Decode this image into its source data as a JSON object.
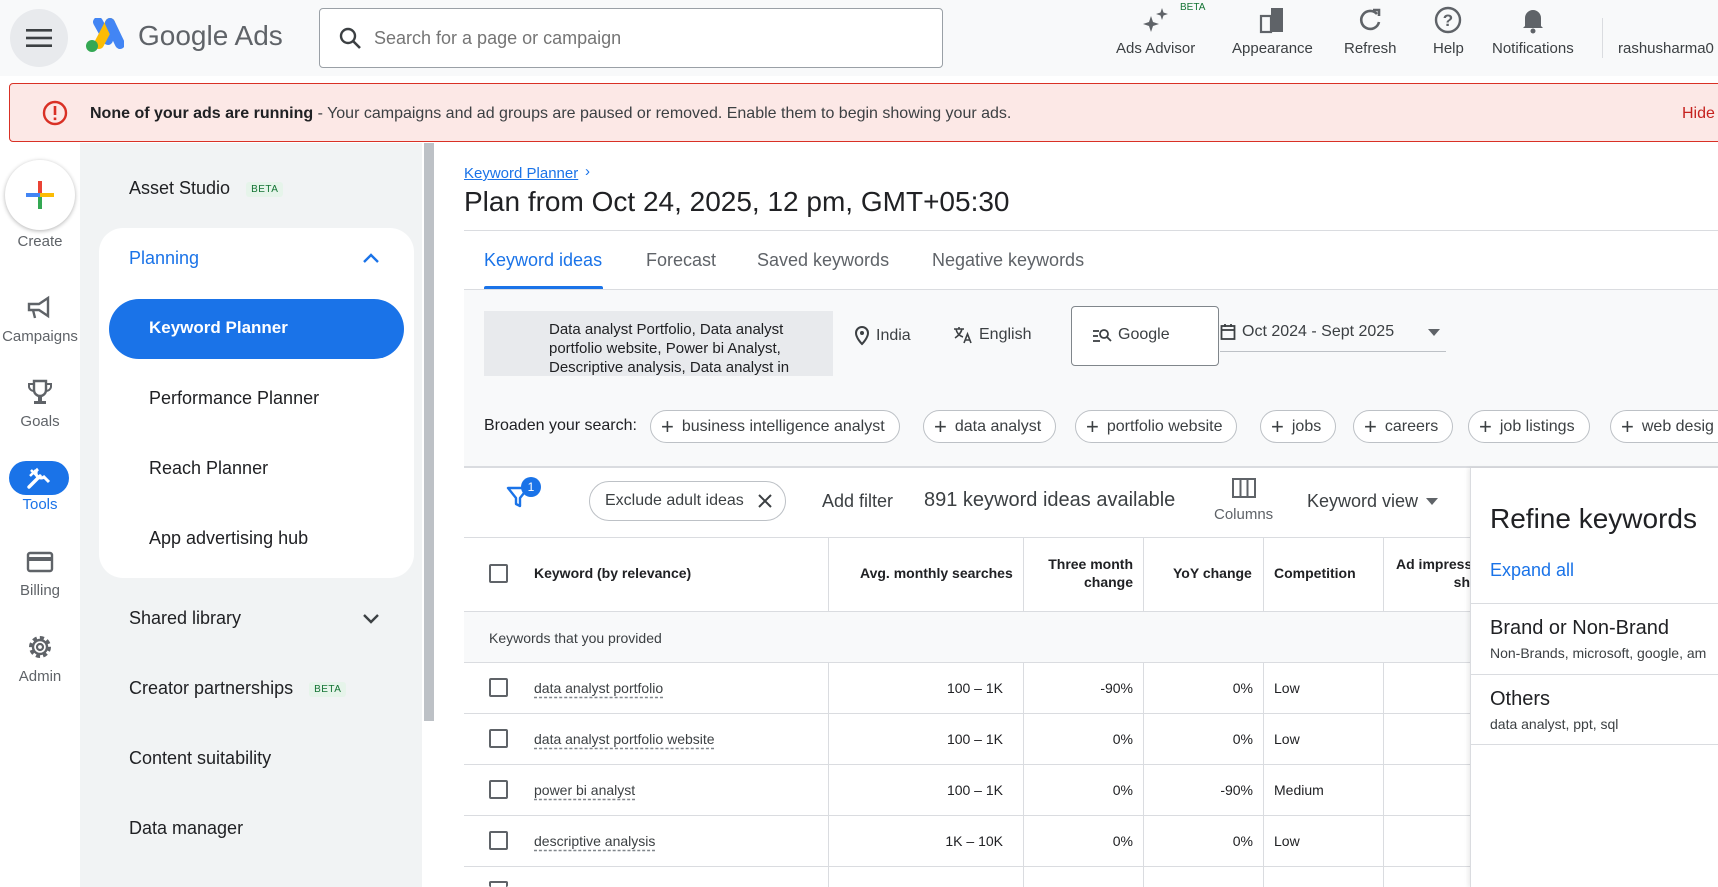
{
  "header": {
    "brand_google": "Google",
    "brand_ads": "Ads",
    "search_placeholder": "Search for a page or campaign",
    "tools": [
      "Ads Advisor",
      "Appearance",
      "Refresh",
      "Help",
      "Notifications"
    ],
    "beta": "BETA",
    "account": "rashusharma0"
  },
  "banner": {
    "bold": "None of your ads are running",
    "text": " - Your campaigns and ad groups are paused or removed. Enable them to begin showing your ads.",
    "hide": "Hide"
  },
  "rail": {
    "create": "Create",
    "items": [
      "Campaigns",
      "Goals",
      "Tools",
      "Billing",
      "Admin"
    ]
  },
  "sidebar": {
    "asset_studio": "Asset Studio",
    "planning": "Planning",
    "planning_items": [
      "Keyword Planner",
      "Performance Planner",
      "Reach Planner",
      "App advertising hub"
    ],
    "shared_library": "Shared library",
    "creator_partnerships": "Creator partnerships",
    "content_suitability": "Content suitability",
    "data_manager": "Data manager",
    "beta": "BETA"
  },
  "main": {
    "breadcrumb": "Keyword Planner",
    "title": "Plan from Oct 24, 2025, 12 pm, GMT+05:30",
    "tabs": [
      "Keyword ideas",
      "Forecast",
      "Saved keywords",
      "Negative keywords"
    ],
    "seed_keywords": "Data analyst Portfolio, Data analyst portfolio website, Power bi Analyst, Descriptive analysis, Data analyst in",
    "location": "India",
    "language": "English",
    "network": "Google",
    "date_range": "Oct 2024 - Sept 2025",
    "broaden_label": "Broaden your search:",
    "broaden_chips": [
      "business intelligence analyst",
      "data analyst",
      "portfolio website",
      "jobs",
      "careers",
      "job listings",
      "web desig"
    ],
    "filter_count": "1",
    "exclude_chip": "Exclude adult ideas",
    "add_filter": "Add filter",
    "idea_count": "891 keyword ideas available",
    "columns": "Columns",
    "keyword_view": "Keyword view"
  },
  "table": {
    "headers": {
      "keyword": "Keyword (by relevance)",
      "avg": "Avg. monthly searches",
      "three_month_1": "Three month",
      "three_month_2": "change",
      "yoy": "YoY change",
      "competition": "Competition",
      "ad_impr_1": "Ad impress",
      "ad_impr_2": "sh"
    },
    "group_label": "Keywords that you provided",
    "rows": [
      {
        "keyword": "data analyst portfolio",
        "avg": "100 – 1K",
        "three": "-90%",
        "yoy": "0%",
        "comp": "Low"
      },
      {
        "keyword": "data analyst portfolio website",
        "avg": "100 – 1K",
        "three": "0%",
        "yoy": "0%",
        "comp": "Low"
      },
      {
        "keyword": "power bi analyst",
        "avg": "100 – 1K",
        "three": "0%",
        "yoy": "-90%",
        "comp": "Medium"
      },
      {
        "keyword": "descriptive analysis",
        "avg": "1K – 10K",
        "three": "0%",
        "yoy": "0%",
        "comp": "Low"
      }
    ]
  },
  "refine": {
    "title": "Refine keywords",
    "expand_all": "Expand all",
    "groups": [
      {
        "name": "Brand or Non-Brand",
        "items": "Non-Brands, microsoft, google, am"
      },
      {
        "name": "Others",
        "items": "data analyst, ppt, sql"
      }
    ]
  },
  "colors": {
    "accent": "#1a73e8",
    "error": "#d93025",
    "beta_green": "#137333"
  }
}
